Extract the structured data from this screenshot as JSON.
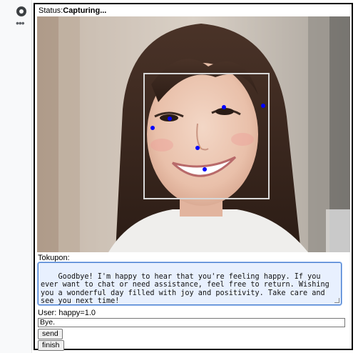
{
  "status": {
    "prefix": "Status:",
    "value": "Capturing..."
  },
  "video": {
    "landmark_count": 6,
    "landmark_color": "#0000ff",
    "face_box_color": "#d8d8d8"
  },
  "bot": {
    "label": "Tokupon:",
    "message": "Goodbye! I'm happy to hear that you're feeling happy. If you ever want to chat or need assistance, feel free to return. Wishing you a wonderful day filled with joy and positivity. Take care and see you next time!"
  },
  "user": {
    "label": "User: happy=1.0",
    "input_value": "Bye."
  },
  "buttons": {
    "send": "send",
    "finish": "finish"
  },
  "gutter": {
    "run_icon": "run-cell-icon",
    "more_icon": "more-options-icon"
  }
}
